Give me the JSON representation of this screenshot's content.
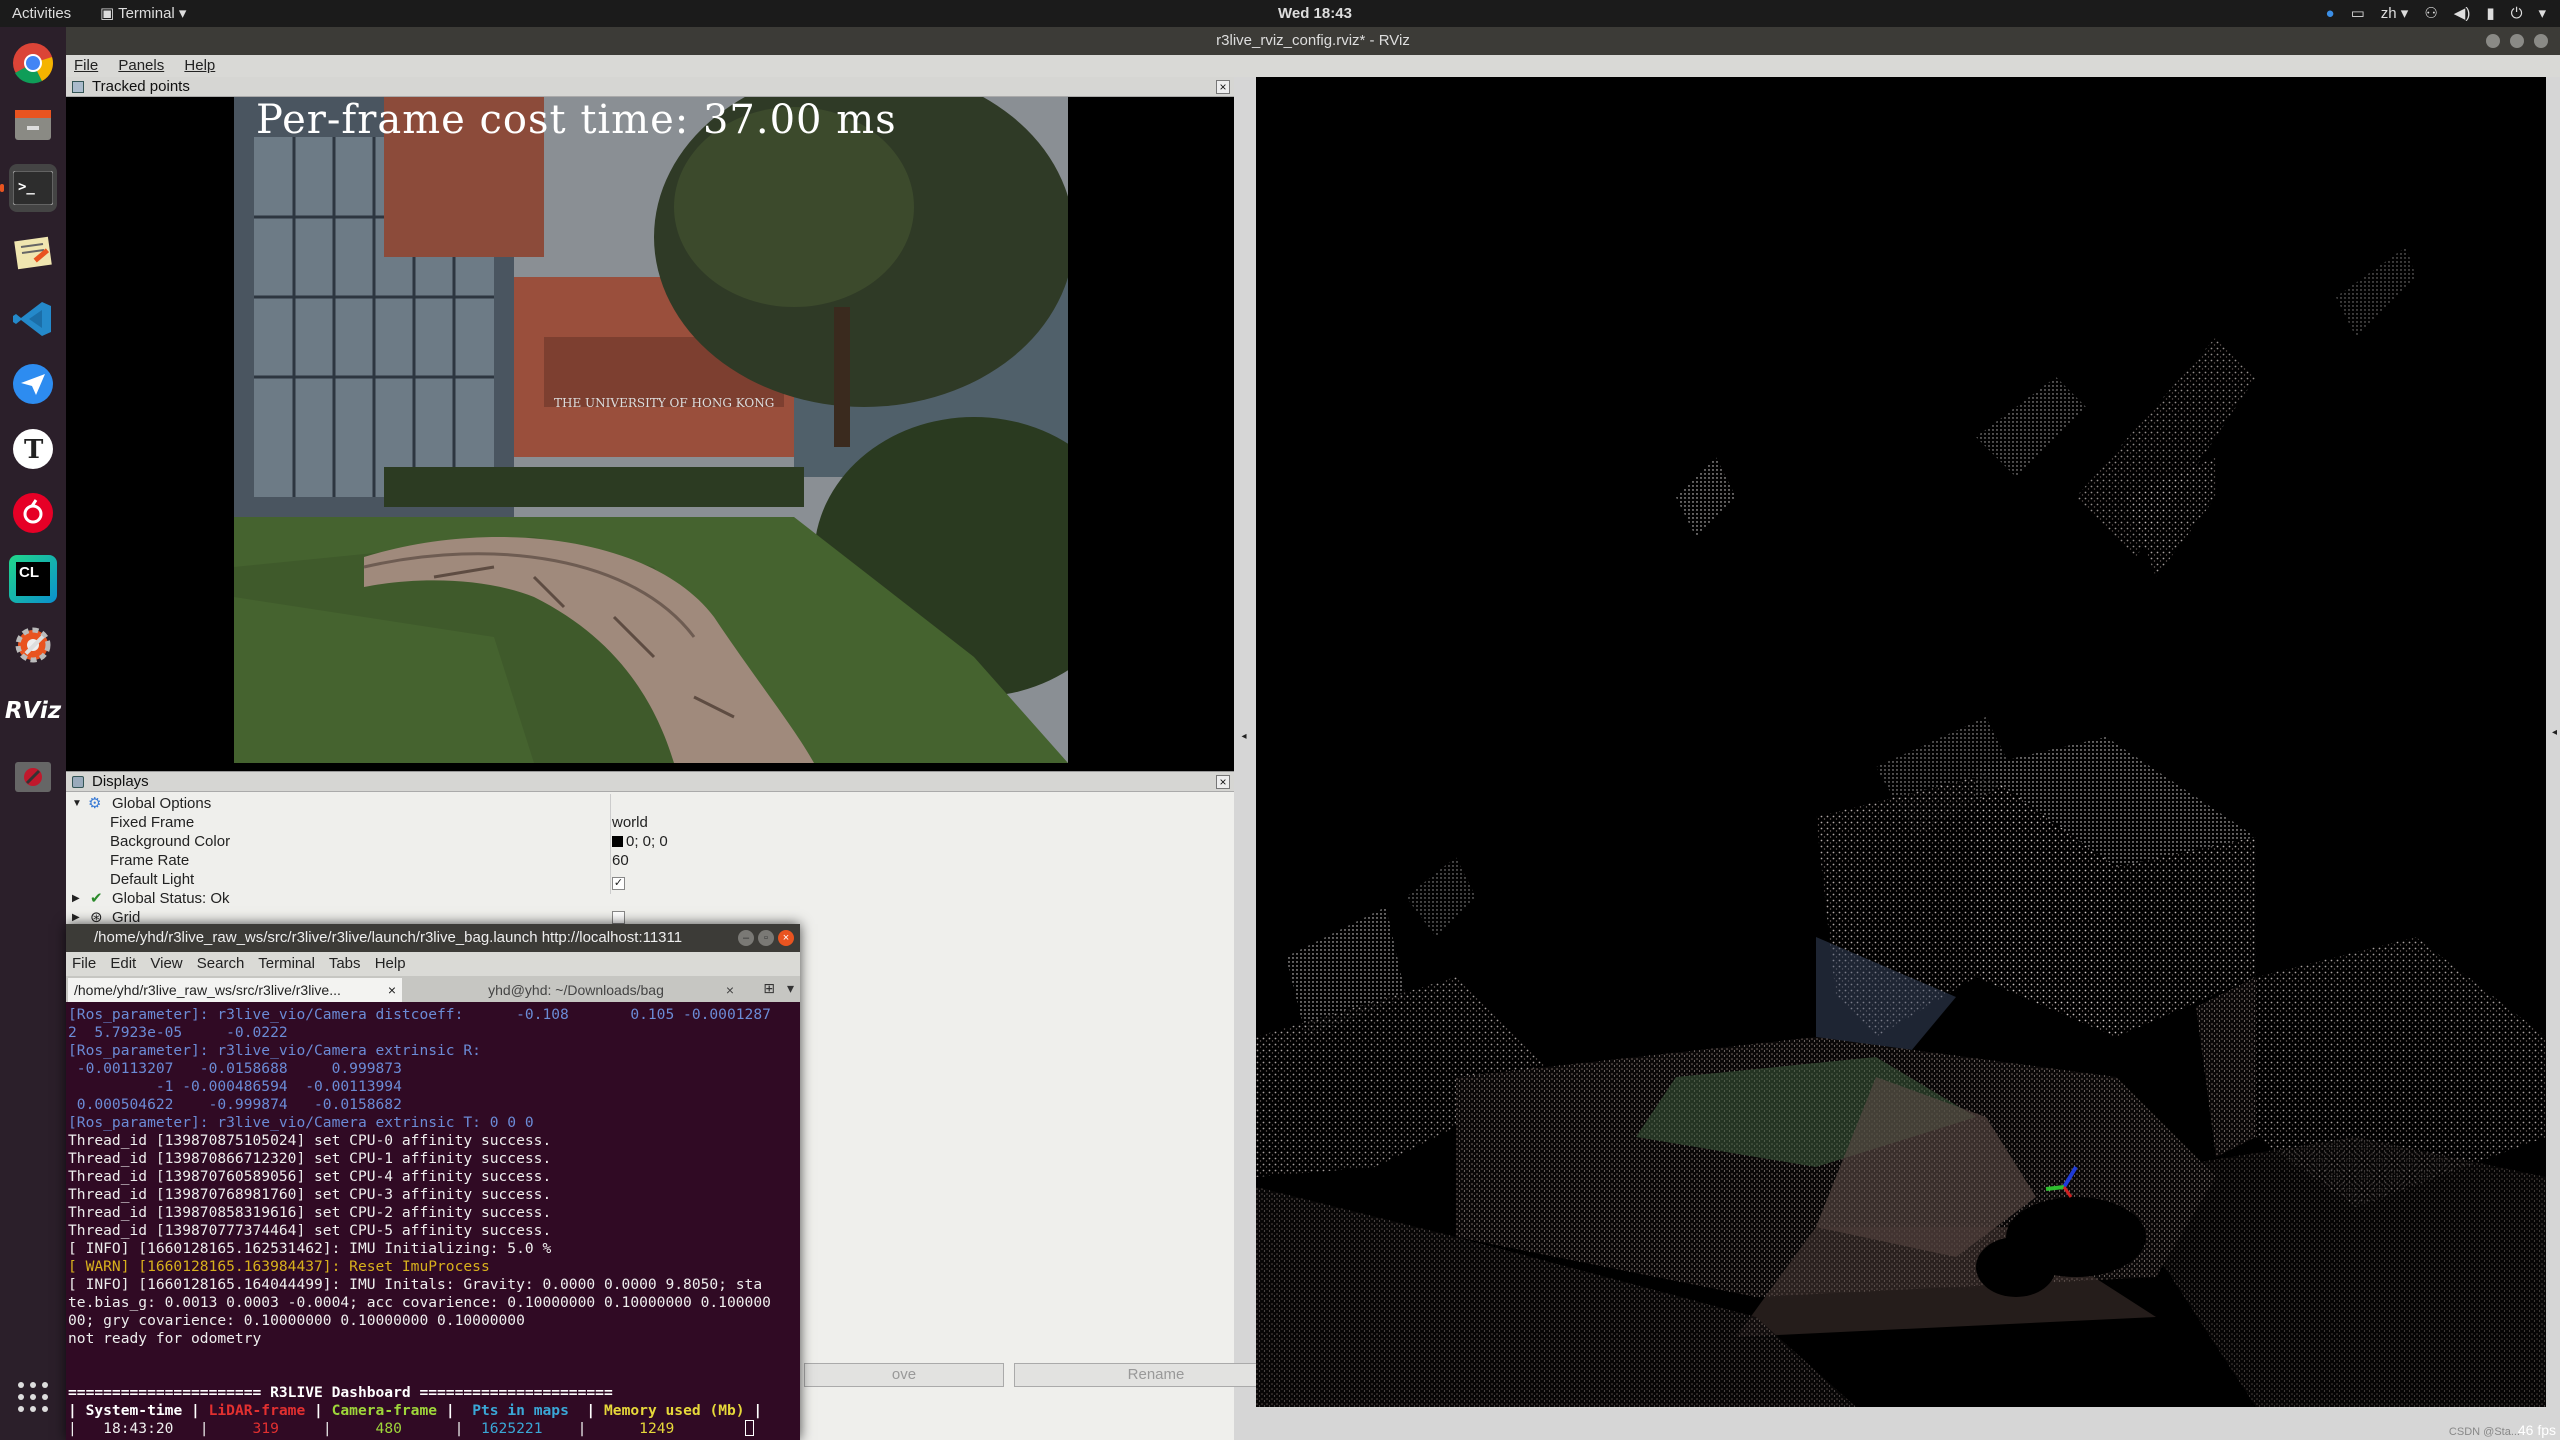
{
  "topbar": {
    "activities": "Activities",
    "app_menu": "Terminal ▾",
    "clock": "Wed 18:43",
    "tray_lang": "zh ▾",
    "tray_caret": "▾"
  },
  "dock": {
    "items": [
      "chrome-icon",
      "files-icon",
      "terminal-icon",
      "text-editor-icon",
      "vscode-icon",
      "feishu-icon",
      "typora-icon",
      "netease-music-icon",
      "clion-icon",
      "settings-icon",
      "rviz-icon",
      "recorder-icon"
    ],
    "typora_letter": "T",
    "clion_letter": "CL",
    "rviz_label": "RViz"
  },
  "rviz": {
    "title": "r3live_rviz_config.rviz* - RViz",
    "menu": [
      "File",
      "Panels",
      "Help"
    ],
    "tracked_panel_title": "Tracked points",
    "overlay_text": "Per-frame cost time: 37.00 ms",
    "displays_title": "Displays",
    "tree": {
      "global_options": "Global Options",
      "fixed_frame": "Fixed Frame",
      "fixed_frame_value": "world",
      "background_color": "Background Color",
      "background_color_value": "0; 0; 0",
      "frame_rate": "Frame Rate",
      "frame_rate_value": "60",
      "default_light": "Default Light",
      "global_status": "Global Status: Ok",
      "grid": "Grid"
    },
    "buttons": {
      "move": "ove",
      "rename": "Rename"
    },
    "fps": "46 fps",
    "watermark": "CSDN @Sta..."
  },
  "terminal": {
    "title": "/home/yhd/r3live_raw_ws/src/r3live/r3live/launch/r3live_bag.launch http://localhost:11311",
    "menu": [
      "File",
      "Edit",
      "View",
      "Search",
      "Terminal",
      "Tabs",
      "Help"
    ],
    "tab1": "/home/yhd/r3live_raw_ws/src/r3live/r3live...",
    "tab2": "yhd@yhd: ~/Downloads/bag",
    "lines": [
      "[Ros_parameter]: r3live_vio/Camera distcoeff:      -0.108       0.105 -0.0001287",
      "2  5.7923e-05     -0.0222",
      "[Ros_parameter]: r3live_vio/Camera extrinsic R:",
      " -0.00113207   -0.0158688     0.999873",
      "          -1 -0.000486594  -0.00113994",
      " 0.000504622    -0.999874   -0.0158682",
      "[Ros_parameter]: r3live_vio/Camera extrinsic T: 0 0 0",
      "Thread_id [139870875105024] set CPU-0 affinity success.",
      "Thread_id [139870866712320] set CPU-1 affinity success.",
      "Thread_id [139870760589056] set CPU-4 affinity success.",
      "Thread_id [139870768981760] set CPU-3 affinity success.",
      "Thread_id [139870858319616] set CPU-2 affinity success.",
      "Thread_id [139870777374464] set CPU-5 affinity success.",
      "[ INFO] [1660128165.162531462]: IMU Initializing: 5.0 %",
      "[ WARN] [1660128165.163984437]: Reset ImuProcess",
      "[ INFO] [1660128165.164044499]: IMU Initals: Gravity: 0.0000 0.0000 9.8050; sta",
      "te.bias_g: 0.0013 0.0003 -0.0004; acc covarience: 0.10000000 0.10000000 0.100000",
      "00; gry covarience: 0.10000000 0.10000000 0.10000000",
      "not ready for odometry",
      "",
      "",
      "====================== R3LIVE Dashboard ======================"
    ],
    "dash_headers": [
      "System-time",
      "LiDAR-frame",
      "Camera-frame",
      "Pts in maps",
      "Memory used (Mb)"
    ],
    "dash_values": [
      "18:43:20",
      "319",
      "480",
      "1625221",
      "1249"
    ],
    "colors": {
      "param": "#6b8bd6",
      "warn": "#d8b11d",
      "lidar": "#e23030",
      "camera": "#9ed63a",
      "pts": "#3aa7d6",
      "mem": "#e6d83a"
    }
  }
}
